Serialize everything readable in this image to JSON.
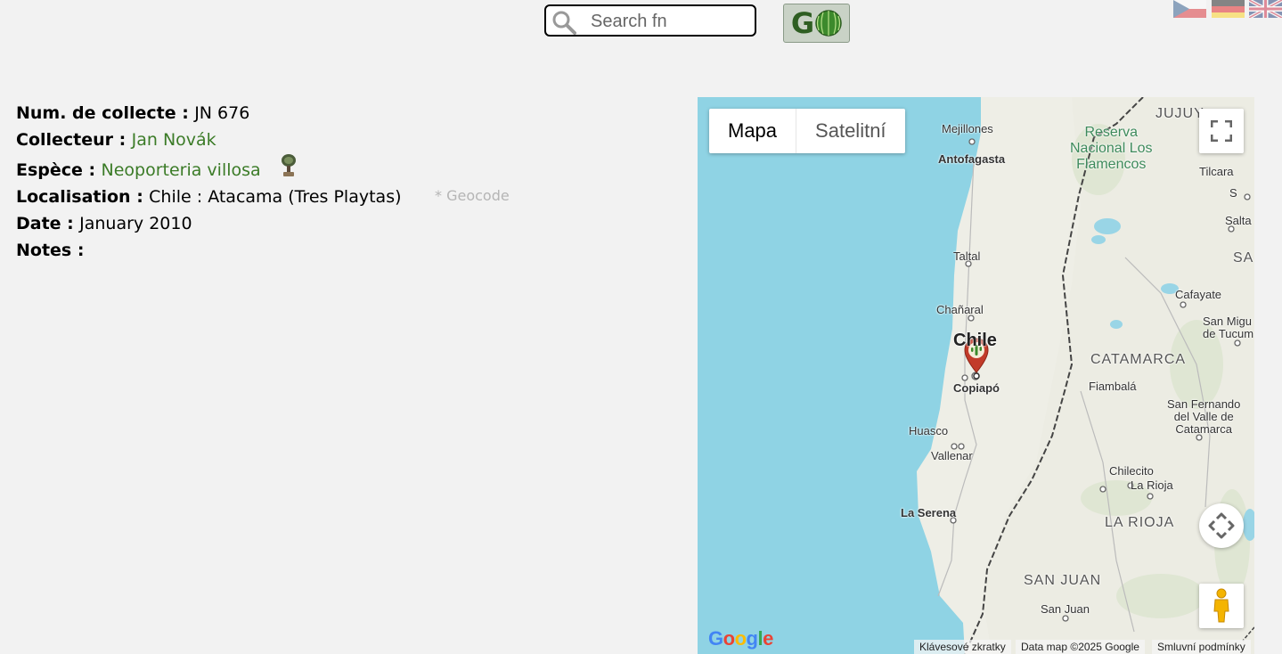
{
  "search": {
    "placeholder": "Search fn",
    "go_label": "G"
  },
  "flags": [
    "czech-flag-icon",
    "german-flag-icon",
    "uk-flag-icon"
  ],
  "details": {
    "number_label": "Num. de collecte :",
    "number_value": "JN 676",
    "collector_label": "Collecteur :",
    "collector_value": "Jan Novák",
    "species_label": "Espèce :",
    "species_value": "Neoporteria villosa",
    "location_label": "Localisation :",
    "location_value": "Chile : Atacama (Tres Playtas)",
    "geocode": "* Geocode",
    "date_label": "Date :",
    "date_value": "January 2010",
    "notes_label": "Notes :"
  },
  "map": {
    "type_map": "Mapa",
    "type_satellite": "Satelitní",
    "labels": {
      "mejillones": "Mejillones",
      "antofagasta": "Antofagasta",
      "taltal": "Taltal",
      "chanaral": "Chañaral",
      "chile": "Chile",
      "copiapo": "Copiapó",
      "huasco": "Huasco",
      "vallenar": "Vallenar",
      "la_serena": "La Serena",
      "jujuy": "JUJUY",
      "reserva": "Reserva\nNacional Los\nFlamencos",
      "tilcara": "Tilcara",
      "salta": "Salta",
      "sa": "SA",
      "s": "S",
      "cafayate": "Cafayate",
      "san_miguel": "San Migu\nde Tucum",
      "catamarca": "CATAMARCA",
      "fiambala": "Fiambalá",
      "san_fernando": "San Fernando\ndel Valle de\nCatamarca",
      "chilecito": "Chilecito",
      "la_rioja_city": "La Rioja",
      "la_rioja_region": "LA RIOJA",
      "san_juan_region": "SAN JUAN",
      "san_juan_city": "San Juan"
    },
    "attribution_shortcuts": "Klávesové zkratky",
    "attribution_data": "Data map ©2025 Google",
    "attribution_terms": "Smluvní podmínky",
    "google_logo": "Google"
  }
}
